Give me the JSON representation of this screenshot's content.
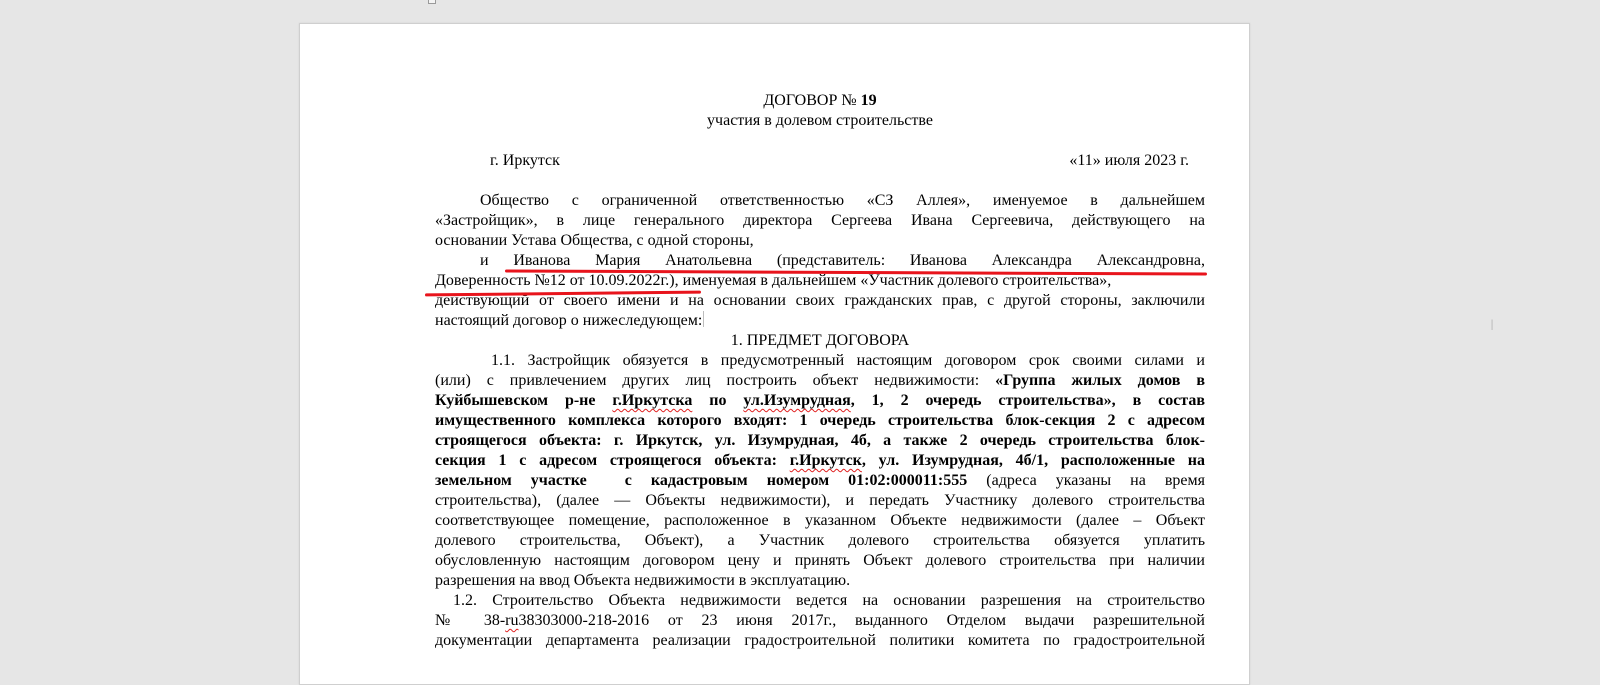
{
  "document": {
    "title_prefix": "ДОГОВОР №",
    "title_number": "19",
    "subtitle": "участия в долевом строительстве",
    "city": "г. Иркутск",
    "date": "«11» июля 2023 г.",
    "intro": {
      "line1": "Общество с ограниченной ответственностью «СЗ Аллея», именуемое в дальнейшем",
      "line2": "«Застройщик», в лице генерального директора Сергеева Ивана Сергеевича, действующего на",
      "line3": "основании Устава Общества, с одной стороны,",
      "line4_start": "и ",
      "line4_highlight": "Иванова Мария Анатольевна (представитель: Иванова Александра Александровна,",
      "line5_highlight": "Доверенность №12 от 10.09.2022г.",
      "line5_end": "), именуемая в дальнейшем «Участник долевого строительства»,",
      "line6": "действующий от своего имени и на основании своих гражданских прав, с другой стороны, заключили",
      "line7": "настоящий договор о нижеследующем:"
    },
    "section1_heading": "1. ПРЕДМЕТ ДОГОВОРА",
    "p11": {
      "l1": "1.1. Застройщик обязуется в предусмотренный настоящим договором срок своими силами и",
      "l2_plain": "(или) с привлечением других лиц построить объект недвижимости: ",
      "l2_bold": "«Группа жилых домов в",
      "l3_a": "Куйбышевском р-не ",
      "l3_sq1": "г.Иркутска",
      "l3_b": " по ",
      "l3_sq2": "ул.Изумрудная",
      "l3_c": ", 1, 2 очередь строительства», в состав",
      "l4": "имущественного комплекса которого входят: 1 очередь строительства блок-секция 2 с адресом",
      "l5": "строящегося объекта: г. Иркутск, ул. Изумрудная, 4б, а также 2 очередь строительства блок-",
      "l6_a": "секция 1 с адресом строящегося объекта: ",
      "l6_sq": "г.Иркутск",
      "l6_b": ", ул. Изумрудная, 4б/1, расположенные на",
      "l7_bold": "земельном участке  с кадастровым номером 01:02:000011:555",
      "l7_plain": " (адреса указаны на время",
      "l8": "строительства), (далее — Объекты недвижимости), и передать Участнику долевого строительства",
      "l9": "соответствующее помещение, расположенное в указанном Объекте недвижимости (далее – Объект",
      "l10": "долевого строительства, Объект), а Участник долевого строительства обязуется уплатить",
      "l11": "обусловленную настоящим договором цену и принять Объект долевого строительства при наличии",
      "l12": "разрешения на ввод Объекта недвижимости в эксплуатацию."
    },
    "p12": {
      "l1": "1.2. Строительство Объекта недвижимости ведется на основании разрешения на строительство",
      "l2_a": "№ 38-",
      "l2_sq": "ru",
      "l2_b": "38303000-218-2016 от 23 июня 2017г., выданного Отделом выдачи разрешительной",
      "l3": "документации департамента реализации градостроительной политики комитета по градостроительной"
    }
  },
  "colors": {
    "annotation_underline": "#e8141c",
    "spellcheck": "#e02020",
    "page": "#ffffff",
    "workspace": "#e6e6e6"
  }
}
